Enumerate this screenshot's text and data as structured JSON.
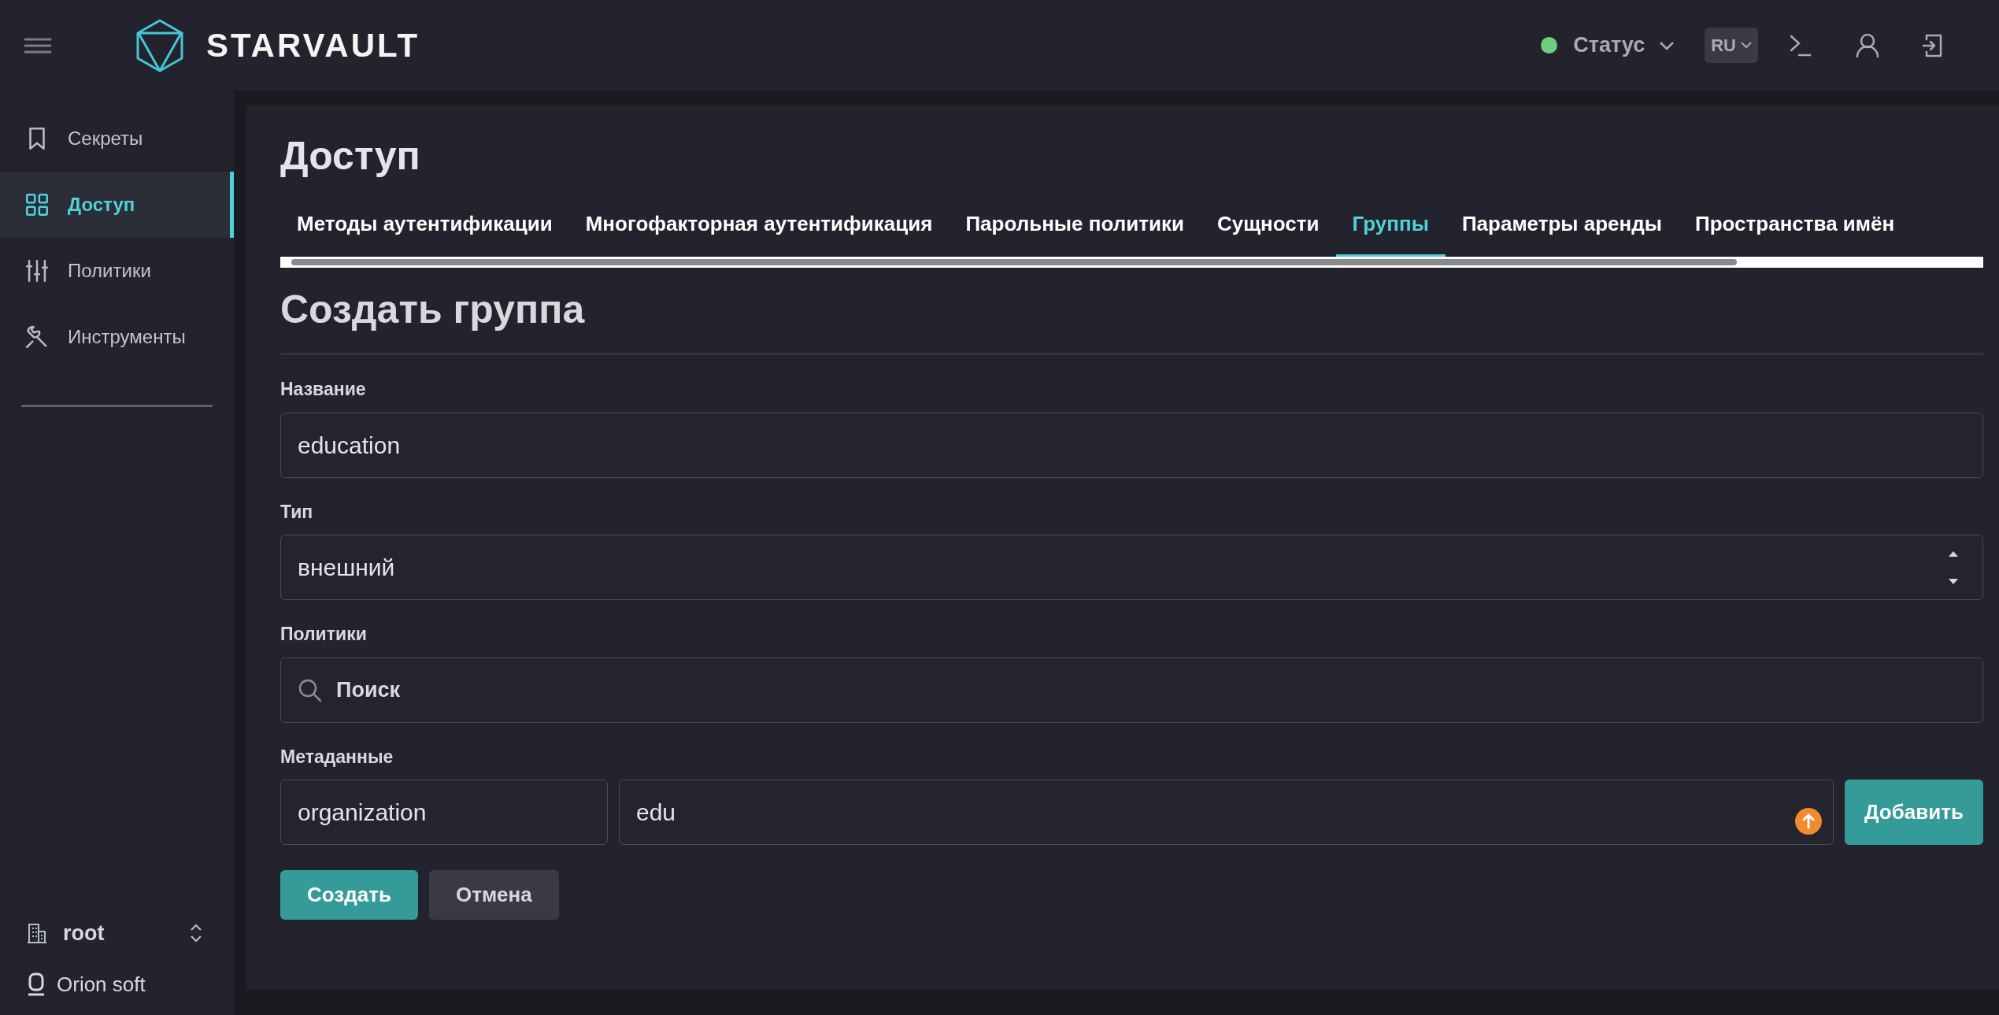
{
  "header": {
    "logo_text": "STARVAULT",
    "status": {
      "label": "Статус",
      "color": "#6fcf7f"
    },
    "language": "RU"
  },
  "sidebar": {
    "items": [
      {
        "label": "Секреты",
        "selected": false
      },
      {
        "label": "Доступ",
        "selected": true
      },
      {
        "label": "Политики",
        "selected": false
      },
      {
        "label": "Инструменты",
        "selected": false
      }
    ],
    "namespace": "root",
    "organization": "Orion soft"
  },
  "page": {
    "title": "Доступ",
    "tabs": [
      {
        "label": "Методы аутентификации",
        "selected": false
      },
      {
        "label": "Многофакторная аутентификация",
        "selected": false
      },
      {
        "label": "Парольные политики",
        "selected": false
      },
      {
        "label": "Сущности",
        "selected": false
      },
      {
        "label": "Группы",
        "selected": true
      },
      {
        "label": "Параметры аренды",
        "selected": false
      },
      {
        "label": "Пространства имён",
        "selected": false
      }
    ]
  },
  "form": {
    "title": "Создать группа",
    "name": {
      "label": "Название",
      "value": "education"
    },
    "type": {
      "label": "Тип",
      "value": "внешний"
    },
    "policies": {
      "label": "Политики",
      "placeholder": "Поиск"
    },
    "metadata": {
      "label": "Метаданные",
      "key": "organization",
      "value": "edu",
      "add_button": "Добавить"
    },
    "buttons": [
      {
        "label": "Создать",
        "kind": "primary"
      },
      {
        "label": "Отмена",
        "kind": "secondary"
      }
    ]
  }
}
